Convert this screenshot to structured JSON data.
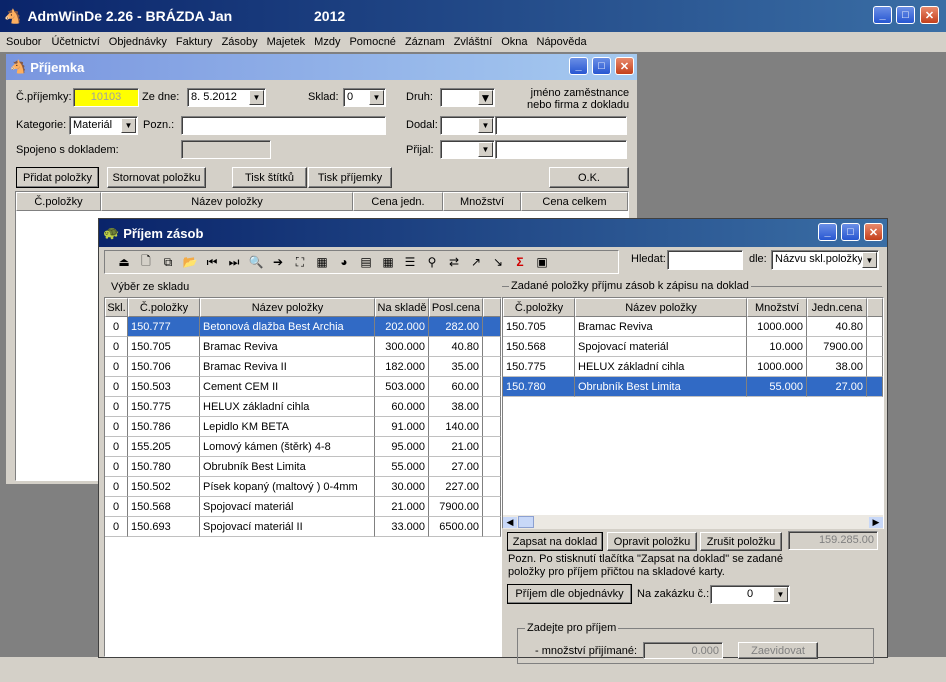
{
  "app": {
    "title": "AdmWinDe 2.26 - BRÁZDA Jan",
    "year": "2012",
    "menu": [
      "Soubor",
      "Účetnictví",
      "Objednávky",
      "Faktury",
      "Zásoby",
      "Majetek",
      "Mzdy",
      "Pomocné",
      "Záznam",
      "Zvláštní",
      "Okna",
      "Nápověda"
    ]
  },
  "prijemka": {
    "title": "Příjemka",
    "cislo_label": "Č.příjemky:",
    "cislo_value": "10103",
    "ze_dne_label": "Ze dne:",
    "ze_dne_value": "8. 5.2012",
    "sklad_label": "Sklad:",
    "sklad_value": "0",
    "druh_label": "Druh:",
    "hint": "jméno zaměstnance\nnebo firma z dokladu",
    "kategorie_label": "Kategorie:",
    "kategorie_value": "Materiál",
    "pozn_label": "Pozn.:",
    "dodal_label": "Dodal:",
    "prijal_label": "Přijal:",
    "spojeno_label": "Spojeno s dokladem:",
    "buttons": {
      "pridat": "Přidat položky",
      "stornovat": "Stornovat položku",
      "tisk_stitku": "Tisk štítků",
      "tisk_prijemky": "Tisk příjemky",
      "ok": "O.K."
    },
    "columns": [
      "Č.položky",
      "Název položky",
      "Cena jedn.",
      "Množství",
      "Cena celkem"
    ]
  },
  "prijem": {
    "title": "Příjem zásob",
    "hledat_label": "Hledat:",
    "dle_label": "dle:",
    "dle_value": "Názvu skl.položky",
    "vyber_label": "Výběr ze skladu",
    "left_columns": [
      "Skl.",
      "Č.položky",
      "Název položky",
      "Na skladě",
      "Posl.cena"
    ],
    "left_rows": [
      [
        "0",
        "150.777",
        "Betonová dlažba Best Archia",
        "202.000",
        "282.00"
      ],
      [
        "0",
        "150.705",
        "Bramac Reviva",
        "300.000",
        "40.80"
      ],
      [
        "0",
        "150.706",
        "Bramac Reviva II",
        "182.000",
        "35.00"
      ],
      [
        "0",
        "150.503",
        "Cement CEM II",
        "503.000",
        "60.00"
      ],
      [
        "0",
        "150.775",
        "HELUX základní cihla",
        "60.000",
        "38.00"
      ],
      [
        "0",
        "150.786",
        "Lepidlo KM BETA",
        "91.000",
        "140.00"
      ],
      [
        "0",
        "155.205",
        "Lomový kámen (štěrk) 4-8",
        "95.000",
        "21.00"
      ],
      [
        "0",
        "150.780",
        "Obrubník Best Limita",
        "55.000",
        "27.00"
      ],
      [
        "0",
        "150.502",
        "Písek kopaný (maltový ) 0-4mm",
        "30.000",
        "227.00"
      ],
      [
        "0",
        "150.568",
        "Spojovací materiál",
        "21.000",
        "7900.00"
      ],
      [
        "0",
        "150.693",
        "Spojovací materiál II",
        "33.000",
        "6500.00"
      ]
    ],
    "zadane_label": "Zadané položky příjmu zásob k zápisu na doklad",
    "right_columns": [
      "Č.položky",
      "Název položky",
      "Množství",
      "Jedn.cena"
    ],
    "right_rows": [
      [
        "150.705",
        "Bramac Reviva",
        "1000.000",
        "40.80"
      ],
      [
        "150.568",
        "Spojovací materiál",
        "10.000",
        "7900.00"
      ],
      [
        "150.775",
        "HELUX základní cihla",
        "1000.000",
        "38.00"
      ],
      [
        "150.780",
        "Obrubník Best Limita",
        "55.000",
        "27.00"
      ]
    ],
    "buttons": {
      "zapsat": "Zapsat na doklad",
      "opravit": "Opravit položku",
      "zrusit": "Zrušit položku",
      "dle_obj": "Příjem dle objednávky",
      "zaevidovat": "Zaevidovat"
    },
    "total": "159.285.00",
    "note": "Pozn. Po stisknutí tlačítka \"Zapsat na doklad\" se zadané položky pro příjem přičtou na skladové karty.",
    "zakazka_label": "Na zakázku č.:",
    "zakazka_value": "0",
    "zadejte_label": "Zadejte pro příjem",
    "mnozstvi_label": "- množství přijímané:",
    "mnozstvi_value": "0.000"
  }
}
